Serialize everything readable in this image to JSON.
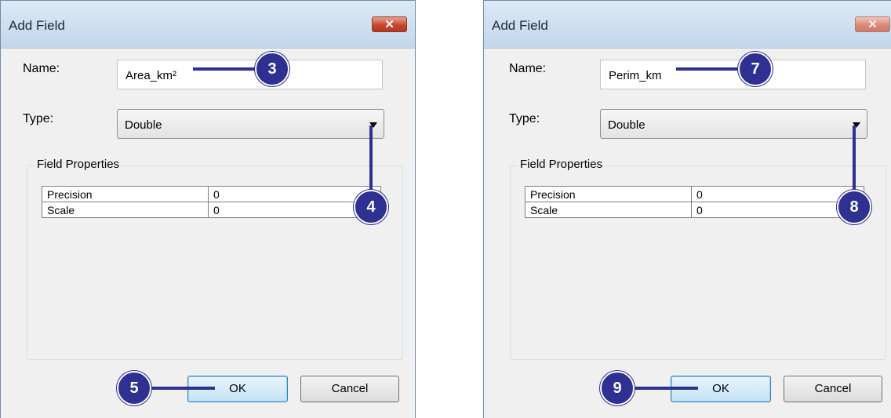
{
  "dialogs": [
    {
      "title": "Add Field",
      "close_symbol": "✕",
      "name_label": "Name:",
      "name_value": "Area_km²",
      "type_label": "Type:",
      "type_value": "Double",
      "group_title": "Field Properties",
      "properties": [
        {
          "key": "Precision",
          "value": "0"
        },
        {
          "key": "Scale",
          "value": "0"
        }
      ],
      "ok_label": "OK",
      "cancel_label": "Cancel",
      "callouts": [
        "3",
        "4",
        "5"
      ]
    },
    {
      "title": "Add Field",
      "close_symbol": "✕",
      "name_label": "Name:",
      "name_value": "Perim_km",
      "type_label": "Type:",
      "type_value": "Double",
      "group_title": "Field Properties",
      "properties": [
        {
          "key": "Precision",
          "value": "0"
        },
        {
          "key": "Scale",
          "value": "0"
        }
      ],
      "ok_label": "OK",
      "cancel_label": "Cancel",
      "callouts": [
        "7",
        "8",
        "9"
      ]
    }
  ],
  "colors": {
    "callout": "#2e3192",
    "titlebar": "#c3d6ea",
    "close": "#c8472f"
  }
}
